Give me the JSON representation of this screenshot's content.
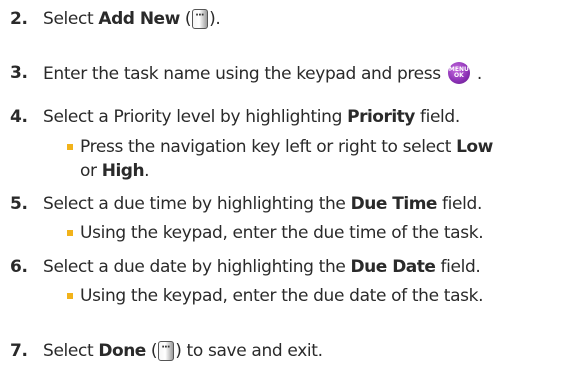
{
  "steps": [
    {
      "num": "2.",
      "pre": "Select ",
      "bold": "Add New",
      "post_open": " (",
      "post_close": ")."
    },
    {
      "num": "3.",
      "pre": "Enter the task name using the keypad and press",
      "post": "."
    },
    {
      "num": "4.",
      "pre": "Select a Priority level by highlighting ",
      "bold": "Priority",
      "post": " field."
    },
    {
      "num": "5.",
      "pre": "Select a due time by highlighting the ",
      "bold": "Due Time",
      "post": " field."
    },
    {
      "num": "6.",
      "pre": "Select a due date by highlighting the ",
      "bold": "Due Date",
      "post": " field."
    },
    {
      "num": "7.",
      "pre": "Select ",
      "bold": "Done",
      "post_open": " (",
      "post_close": ") to save and exit."
    }
  ],
  "sub4": {
    "pre": "Press the navigation key left or right to select ",
    "bold1": "Low",
    "mid": "or ",
    "bold2": "High",
    "post": "."
  },
  "sub5": {
    "text": "Using the keypad, enter the due time of the task."
  },
  "sub6": {
    "text": "Using the keypad, enter the due date of the task."
  },
  "icons": {
    "softkey": "softkey-icon",
    "menu_ok": "menu-ok-icon",
    "menu_text": "MENU",
    "ok_text": "OK",
    "bullet_color": "#f2b31a",
    "menu_color": "#8a2fb4"
  }
}
